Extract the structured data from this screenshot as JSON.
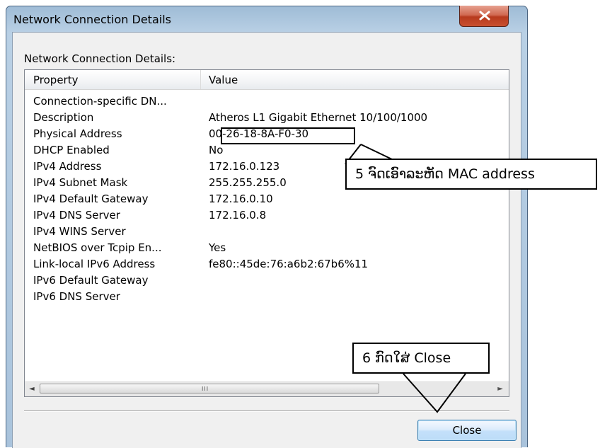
{
  "window": {
    "title": "Network Connection Details",
    "close_glyph": "close-icon"
  },
  "dialog": {
    "section_label": "Network Connection Details:",
    "columns": {
      "property": "Property",
      "value": "Value"
    },
    "rows": [
      {
        "property": "Connection-specific DN...",
        "value": ""
      },
      {
        "property": "Description",
        "value": "Atheros L1 Gigabit Ethernet 10/100/1000"
      },
      {
        "property": "Physical Address",
        "value": "00-26-18-8A-F0-30"
      },
      {
        "property": "DHCP Enabled",
        "value": "No"
      },
      {
        "property": "IPv4 Address",
        "value": "172.16.0.123"
      },
      {
        "property": "IPv4 Subnet Mask",
        "value": "255.255.255.0"
      },
      {
        "property": "IPv4 Default Gateway",
        "value": "172.16.0.10"
      },
      {
        "property": "IPv4 DNS Server",
        "value": "172.16.0.8"
      },
      {
        "property": "IPv4 WINS Server",
        "value": ""
      },
      {
        "property": "NetBIOS over Tcpip En...",
        "value": "Yes"
      },
      {
        "property": "Link-local IPv6 Address",
        "value": "fe80::45de:76:a6b2:67b6%11"
      },
      {
        "property": "IPv6 Default Gateway",
        "value": ""
      },
      {
        "property": "IPv6 DNS Server",
        "value": ""
      }
    ],
    "scrollbar": {
      "left_arrow": "◄",
      "right_arrow": "►",
      "grip": "III"
    },
    "close_button": "Close"
  },
  "annotations": {
    "step5": "5 ຈົດເອົາລະຫັດ MAC address",
    "step6": "6 ກົດໃສ່ Close"
  },
  "colors": {
    "frame": "#a9c3dc",
    "close_red": "#c8502f",
    "button_border": "#3c7fb1"
  }
}
